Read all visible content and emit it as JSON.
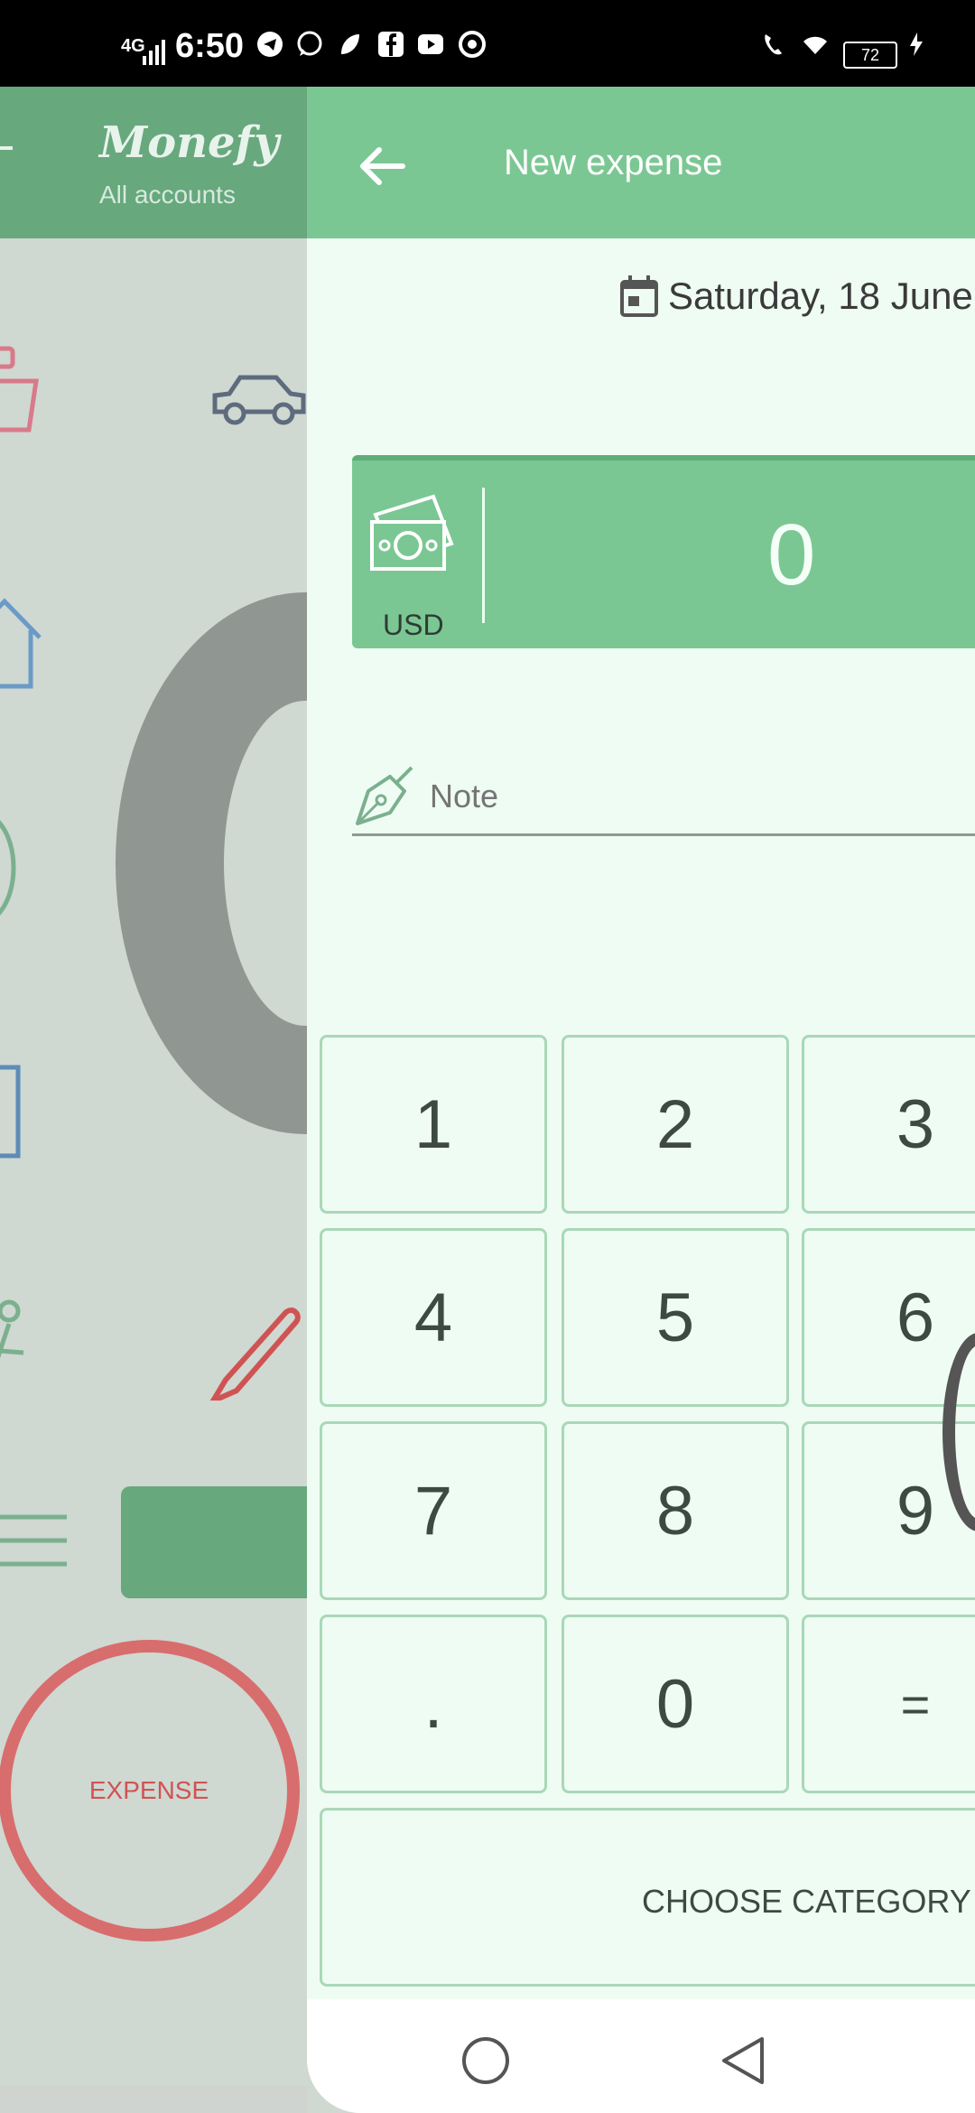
{
  "status_bar": {
    "network": "4G",
    "time": "6:50",
    "battery": "72"
  },
  "background_app": {
    "logo": "Monefy",
    "subtitle": "All accounts",
    "expense_button": "EXPENSE"
  },
  "panel": {
    "title": "New expense",
    "date": "Saturday, 18 June",
    "amount": {
      "currency": "USD",
      "value": "0"
    },
    "note": {
      "placeholder": "Note"
    },
    "keypad": [
      [
        "1",
        "2",
        "3"
      ],
      [
        "4",
        "5",
        "6"
      ],
      [
        "7",
        "8",
        "9"
      ],
      [
        ".",
        "0",
        "="
      ]
    ],
    "choose_category": "CHOOSE CATEGORY"
  },
  "colors": {
    "header_green": "#7bc793",
    "panel_bg": "#effcf3",
    "key_border": "#a9d8b8",
    "expense_red": "#d86d6d"
  }
}
